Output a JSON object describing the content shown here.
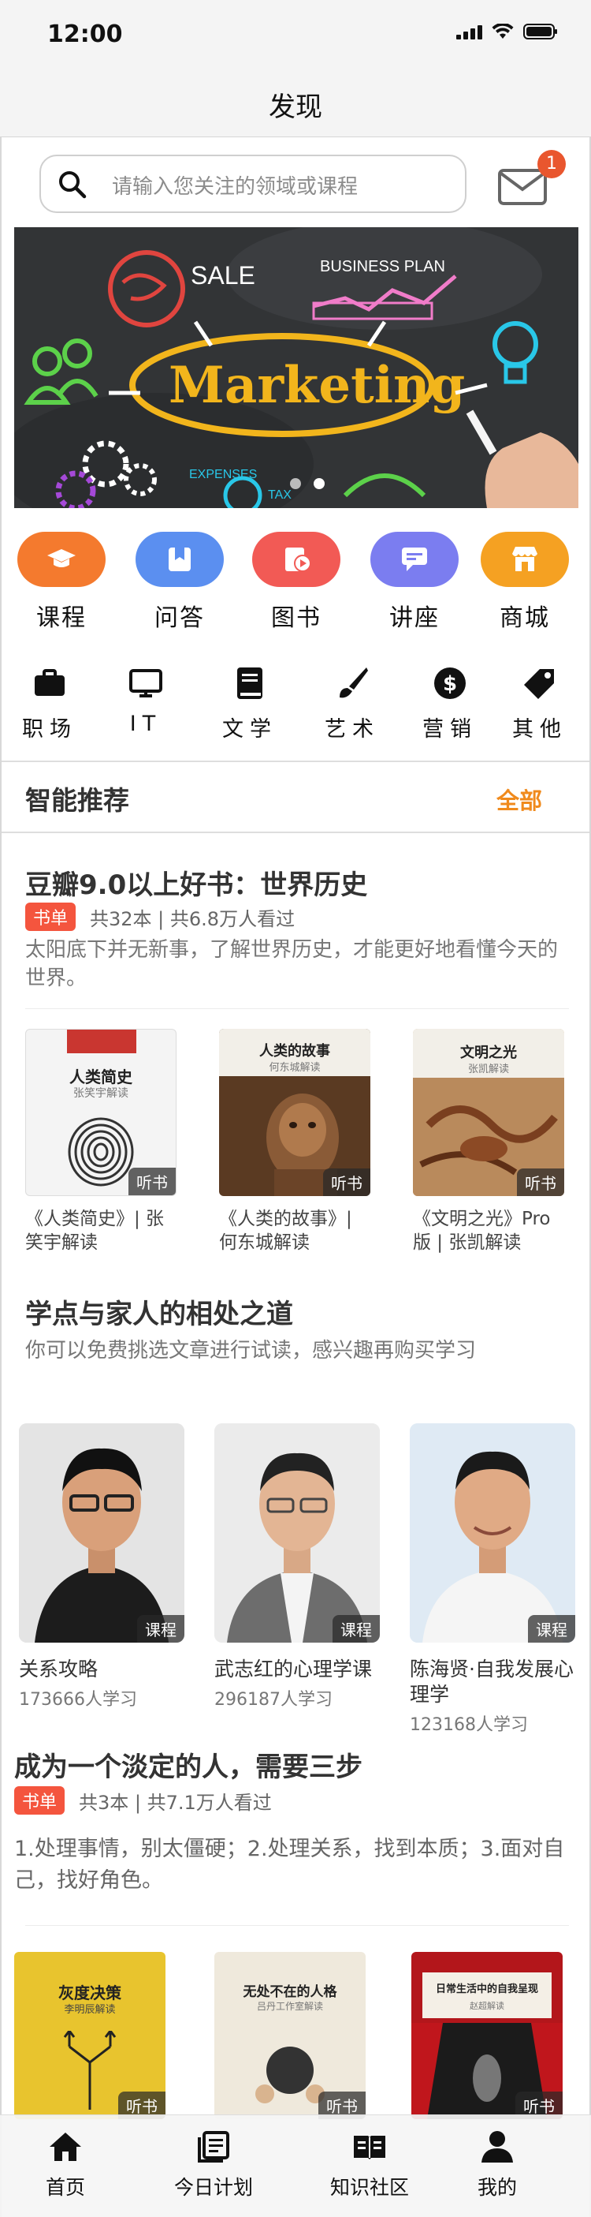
{
  "status": {
    "time": "12:00"
  },
  "nav": {
    "title": "发现"
  },
  "search": {
    "placeholder": "请输入您关注的领域或课程",
    "badge_count": "1"
  },
  "banner": {
    "words": [
      "SALE",
      "BUSINESS PLAN",
      "Marketing",
      "EXPENSES",
      "TAX"
    ],
    "accent": "#f2b51c",
    "active_dot": 1,
    "dot_count": 2
  },
  "categories": [
    {
      "label": "课程",
      "icon": "graduation-cap-icon",
      "color": "#f47a2e"
    },
    {
      "label": "问答",
      "icon": "bookmark-icon",
      "color": "#5b8ff0"
    },
    {
      "label": "图书",
      "icon": "play-book-icon",
      "color": "#f25a55"
    },
    {
      "label": "讲座",
      "icon": "presentation-icon",
      "color": "#7b7df0"
    },
    {
      "label": "商城",
      "icon": "storefront-icon",
      "color": "#f5a122"
    }
  ],
  "subcategories": [
    {
      "label": "职场",
      "icon": "briefcase-icon"
    },
    {
      "label": "IT",
      "icon": "monitor-icon"
    },
    {
      "label": "文学",
      "icon": "book-icon"
    },
    {
      "label": "艺术",
      "icon": "paintbrush-icon"
    },
    {
      "label": "营销",
      "icon": "dollar-coin-icon"
    },
    {
      "label": "其他",
      "icon": "tag-icon"
    }
  ],
  "recommend": {
    "title": "智能推荐",
    "more": "全部"
  },
  "list1": {
    "title": "豆瓣9.0以上好书：世界历史",
    "tag": "书单",
    "meta": "共32本 | 共6.8万人看过",
    "desc": "太阳底下并无新事，了解世界历史，才能更好地看懂今天的世界。",
    "books": [
      {
        "name": "《人类简史》| 张笑宇解读",
        "cover_title": "人类简史",
        "cover_sub": "张笑宇解读",
        "label": "听书"
      },
      {
        "name": "《人类的故事》| 何东城解读",
        "cover_title": "人类的故事",
        "cover_sub": "何东城解读",
        "label": "听书"
      },
      {
        "name": "《文明之光》Pro版 | 张凯解读",
        "cover_title": "文明之光",
        "cover_sub": "张凯解读",
        "label": "听书"
      }
    ]
  },
  "list2": {
    "title": "学点与家人的相处之道",
    "desc": "你可以免费挑选文章进行试读，感兴趣再购买学习",
    "courses": [
      {
        "name": "关系攻略",
        "count": "173666人学习",
        "label": "课程"
      },
      {
        "name": "武志红的心理学课",
        "count": "296187人学习",
        "label": "课程"
      },
      {
        "name": "陈海贤·自我发展心理学",
        "count": "123168人学习",
        "label": "课程"
      }
    ]
  },
  "list3": {
    "title": "成为一个淡定的人，需要三步",
    "tag": "书单",
    "meta": "共3本 | 共7.1万人看过",
    "desc": "1.处理事情，别太僵硬；2.处理关系，找到本质；3.面对自己，找好角色。",
    "books": [
      {
        "cover_title": "灰度决策",
        "cover_sub": "李明辰解读",
        "label": "听书"
      },
      {
        "cover_title": "无处不在的人格",
        "cover_sub": "吕丹工作室解读",
        "label": "听书"
      },
      {
        "cover_title": "日常生活中的自我呈现",
        "cover_sub": "赵超解读",
        "label": "听书"
      }
    ]
  },
  "tabs": [
    {
      "label": "首页",
      "icon": "home-icon"
    },
    {
      "label": "今日计划",
      "icon": "plan-list-icon"
    },
    {
      "label": "知识社区",
      "icon": "open-book-icon"
    },
    {
      "label": "我的",
      "icon": "person-icon"
    }
  ]
}
